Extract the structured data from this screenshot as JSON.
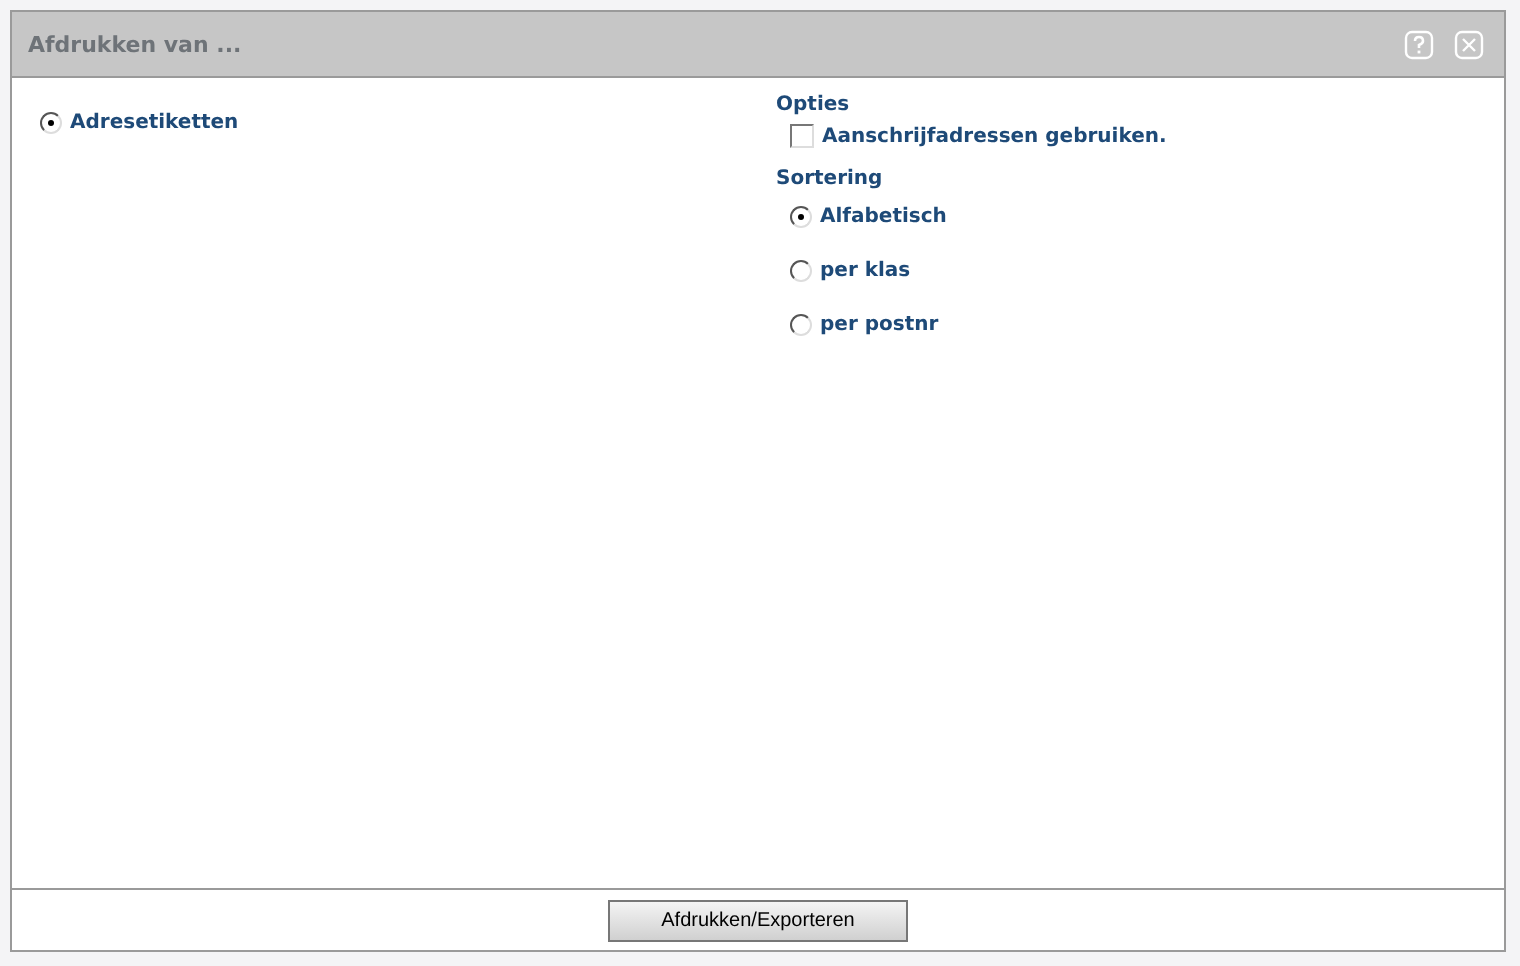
{
  "window": {
    "title": "Afdrukken van ..."
  },
  "reports": [
    {
      "label": "Adresetiketten",
      "selected": true
    }
  ],
  "options": {
    "heading": "Opties",
    "items": [
      {
        "label": "Aanschrijfadressen gebruiken.",
        "checked": false
      }
    ]
  },
  "sorting": {
    "heading": "Sortering",
    "items": [
      {
        "label": "Alfabetisch",
        "selected": true
      },
      {
        "label": "per klas",
        "selected": false
      },
      {
        "label": "per postnr",
        "selected": false
      }
    ]
  },
  "footer": {
    "button": "Afdrukken/Exporteren"
  }
}
